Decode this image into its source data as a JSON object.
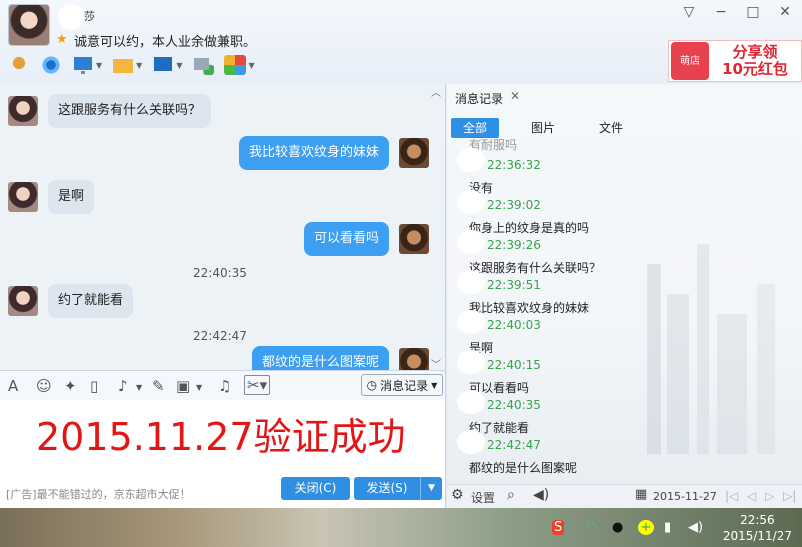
{
  "header": {
    "nickname": "莎",
    "signature": "诚意可以约，本人业余做兼职。",
    "banner": {
      "logo": "萌店",
      "text_line1": "分享领",
      "text_line2": "10元红包"
    }
  },
  "window_controls": {
    "skin": "▽",
    "minimize": "−",
    "maximize": "□",
    "close": "✕"
  },
  "chat": {
    "messages": [
      {
        "side": "left",
        "text": "这跟服务有什么关联吗？"
      },
      {
        "side": "right",
        "text": "我比较喜欢纹身的妹妹"
      },
      {
        "side": "left",
        "text": "是啊"
      },
      {
        "side": "right",
        "text": "可以看看吗"
      },
      {
        "side": "left",
        "text": "约了就能看"
      },
      {
        "side": "right",
        "text": "都纹的是什么图案呢"
      }
    ],
    "timestamps": [
      "22:40:35",
      "22:42:47"
    ]
  },
  "input": {
    "history_button": "消息记录",
    "text": "2015.11.27验证成功"
  },
  "bottom": {
    "ad": "[广告]最不能错过的，京东超市大促！",
    "close_button": "关闭(C)",
    "send_button": "发送(S)"
  },
  "history": {
    "title": "消息记录",
    "tabs": [
      "全部",
      "图片",
      "文件"
    ],
    "active_tab": "全部",
    "items": [
      {
        "text": "有耐服吗",
        "time": "22:36:32"
      },
      {
        "text": "没有",
        "time": "22:39:02"
      },
      {
        "text": "你身上的纹身是真的吗",
        "time": "22:39:26"
      },
      {
        "text": "这跟服务有什么关联吗？",
        "time": "22:39:51"
      },
      {
        "text": "我比较喜欢纹身的妹妹",
        "time": "22:40:03"
      },
      {
        "text": "是啊",
        "time": "22:40:15"
      },
      {
        "text": "可以看看吗",
        "time": "22:40:35"
      },
      {
        "text": "约了就能看",
        "time": "22:42:47"
      },
      {
        "text": "都纹的是什么图案呢",
        "time": ""
      }
    ],
    "footer": {
      "settings": "设置",
      "date": "2015-11-27"
    }
  },
  "taskbar": {
    "time": "22:56",
    "date": "2015/11/27"
  },
  "colors": {
    "accent": "#2f8fe2",
    "bubble_right": "#3c9ff2",
    "time_green": "#3aa24a",
    "input_text": "#e21616"
  }
}
